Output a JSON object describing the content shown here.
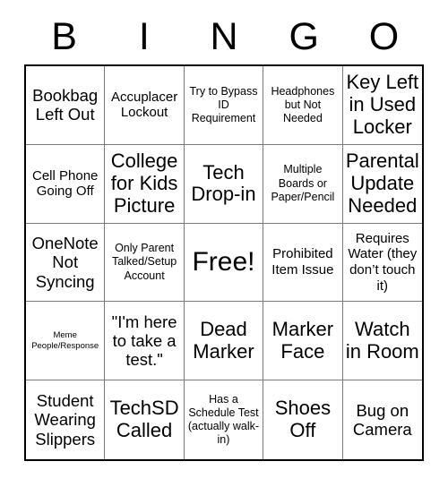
{
  "card": {
    "type": "bingo-card",
    "header_letters": [
      "B",
      "I",
      "N",
      "G",
      "O"
    ],
    "grid_size": 5,
    "free_space_index": 12,
    "colors": {
      "background": "#ffffff",
      "text": "#000000",
      "outer_border": "#000000",
      "inner_gridline": "#7a7a7a"
    },
    "cells": [
      {
        "text": "Bookbag Left Out",
        "size": "lg"
      },
      {
        "text": "Accuplacer Lockout",
        "size": "md"
      },
      {
        "text": "Try to Bypass ID Requirement",
        "size": "sm"
      },
      {
        "text": "Headphones but Not Needed",
        "size": "sm"
      },
      {
        "text": "Key Left in Used Locker",
        "size": "xl"
      },
      {
        "text": "Cell Phone Going Off",
        "size": "md"
      },
      {
        "text": "College for Kids Picture",
        "size": "xl"
      },
      {
        "text": "Tech Drop-in",
        "size": "xl"
      },
      {
        "text": "Multiple Boards or Paper/Pencil",
        "size": "sm"
      },
      {
        "text": "Parental Update Needed",
        "size": "xl"
      },
      {
        "text": "OneNote Not Syncing",
        "size": "lg"
      },
      {
        "text": "Only Parent Talked/Setup Account",
        "size": "sm"
      },
      {
        "text": "Free!",
        "size": "free"
      },
      {
        "text": "Prohibited Item Issue",
        "size": "md"
      },
      {
        "text": "Requires Water (they don’t touch it)",
        "size": "md"
      },
      {
        "text": "Meme People/Response",
        "size": "xs"
      },
      {
        "text": "\"I'm here to take a test.\"",
        "size": "lg"
      },
      {
        "text": "Dead Marker",
        "size": "xl"
      },
      {
        "text": "Marker Face",
        "size": "xl"
      },
      {
        "text": "Watch in Room",
        "size": "xl"
      },
      {
        "text": "Student Wearing Slippers",
        "size": "lg"
      },
      {
        "text": "TechSD Called",
        "size": "xl"
      },
      {
        "text": "Has a Schedule Test (actually walk-in)",
        "size": "sm"
      },
      {
        "text": "Shoes Off",
        "size": "xl"
      },
      {
        "text": "Bug on Camera",
        "size": "lg"
      }
    ]
  }
}
